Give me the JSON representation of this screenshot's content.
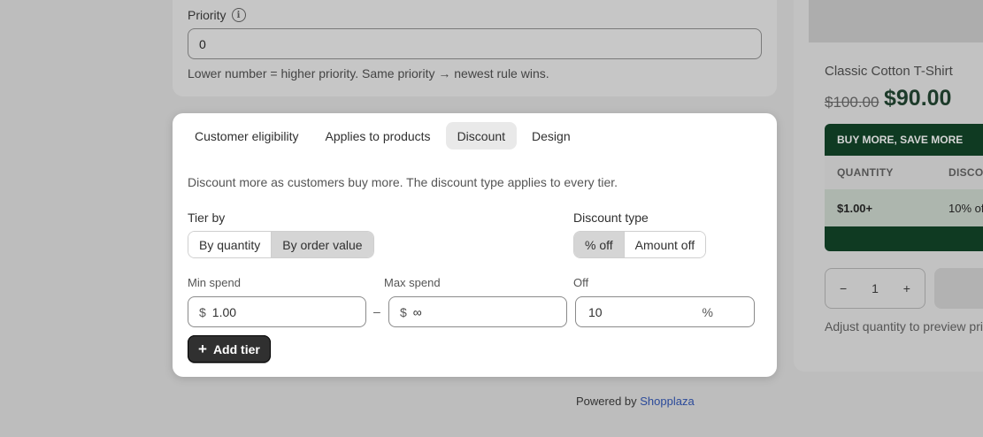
{
  "priority": {
    "label": "Priority",
    "info_icon": "info-icon",
    "value": "0",
    "help": "Lower number = higher priority. Same priority → newest rule wins."
  },
  "preview": {
    "product_title": "Classic Cotton T-Shirt",
    "price_old": "$100.00",
    "price_new": "$90.00",
    "promo_title": "BUY MORE, SAVE MORE",
    "col_quantity": "QUANTITY",
    "col_discount": "DISCOU",
    "row_quantity": "$1.00+",
    "row_discount": "10% of",
    "qty_minus": "−",
    "qty_value": "1",
    "qty_plus": "+",
    "adjust_text": "Adjust quantity to preview pric",
    "accent": "#0f3a22"
  },
  "footer": {
    "powered_prefix": "Powered by ",
    "brand": "Shopplaza"
  },
  "modal": {
    "tabs": [
      {
        "label": "Customer eligibility"
      },
      {
        "label": "Applies to products"
      },
      {
        "label": "Discount",
        "active": true
      },
      {
        "label": "Design"
      }
    ],
    "intro": "Discount more as customers buy more. The discount type applies to every tier.",
    "tier_by": {
      "label": "Tier by",
      "options": [
        "By quantity",
        "By order value"
      ],
      "selected": "By order value"
    },
    "discount_type": {
      "label": "Discount type",
      "options": [
        "% off",
        "Amount off"
      ],
      "selected": "% off"
    },
    "tier": {
      "min_label": "Min spend",
      "max_label": "Max spend",
      "off_label": "Off",
      "currency": "$",
      "min_value": "1.00",
      "max_value": "∞",
      "separator": "–",
      "off_value": "10",
      "off_suffix": "%"
    },
    "add_tier": "Add tier"
  }
}
